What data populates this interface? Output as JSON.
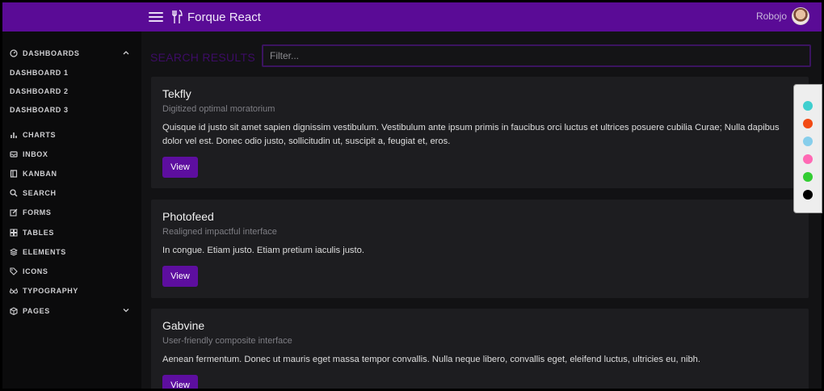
{
  "header": {
    "brand_title": "Forque React",
    "user_name": "Robojo"
  },
  "sidebar": {
    "items": [
      {
        "label": "DASHBOARDS",
        "icon": "gauge-icon",
        "expanded": true
      },
      {
        "label": "CHARTS",
        "icon": "bar-chart-icon"
      },
      {
        "label": "INBOX",
        "icon": "inbox-icon"
      },
      {
        "label": "KANBAN",
        "icon": "kanban-icon"
      },
      {
        "label": "SEARCH",
        "icon": "search-icon"
      },
      {
        "label": "FORMS",
        "icon": "edit-icon"
      },
      {
        "label": "TABLES",
        "icon": "grid-icon"
      },
      {
        "label": "ELEMENTS",
        "icon": "layers-icon"
      },
      {
        "label": "ICONS",
        "icon": "tag-icon"
      },
      {
        "label": "TYPOGRAPHY",
        "icon": "glasses-icon"
      },
      {
        "label": "PAGES",
        "icon": "package-icon",
        "expanded": false
      }
    ],
    "dashboard_subitems": [
      "DASHBOARD 1",
      "DASHBOARD 2",
      "DASHBOARD 3"
    ]
  },
  "main": {
    "search_title": "SEARCH RESULTS",
    "filter_placeholder": "Filter...",
    "results": [
      {
        "title": "Tekfly",
        "subtitle": "Digitized optimal moratorium",
        "text": "Quisque id justo sit amet sapien dignissim vestibulum. Vestibulum ante ipsum primis in faucibus orci luctus et ultrices posuere cubilia Curae; Nulla dapibus dolor vel est. Donec odio justo, sollicitudin ut, suscipit a, feugiat et, eros.",
        "button": "View"
      },
      {
        "title": "Photofeed",
        "subtitle": "Realigned impactful interface",
        "text": "In congue. Etiam justo. Etiam pretium iaculis justo.",
        "button": "View"
      },
      {
        "title": "Gabvine",
        "subtitle": "User-friendly composite interface",
        "text": "Aenean fermentum. Donec ut mauris eget massa tempor convallis. Nulla neque libero, convallis eget, eleifend luctus, ultricies eu, nibh.",
        "button": "View"
      }
    ]
  },
  "theme_palette": {
    "colors": [
      "#3fcfcf",
      "#f24a14",
      "#87ceeb",
      "#ff69b4",
      "#32cd32",
      "#000000"
    ]
  }
}
